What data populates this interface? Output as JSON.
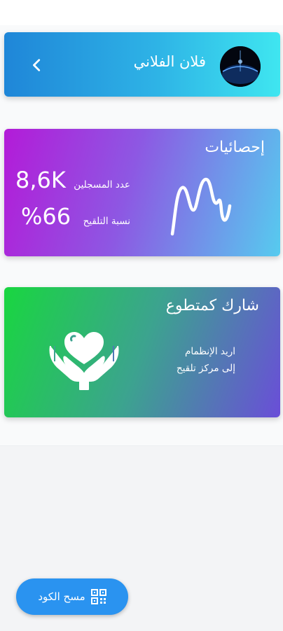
{
  "header": {
    "user_name": "فلان الفلاني",
    "back_icon": "chevron-left-icon",
    "avatar_icon": "planet-avatar"
  },
  "stats": {
    "title": "إحصائيات",
    "registered_label": "عدد المسجلين",
    "registered_value": "8,6K",
    "vaccination_rate_label": "نسبة التلقيح",
    "vaccination_rate_value": "%66",
    "graph_icon": "pulse-graph-icon"
  },
  "volunteer": {
    "title": "شارك كمتطوع",
    "description_line1": "اريد الإنظمام",
    "description_line2": "إلى مركز تلقيح",
    "icon": "hands-heart-icon"
  },
  "scan_button": {
    "label": "مسح الكود",
    "icon": "qr-code-icon"
  },
  "colors": {
    "header_gradient": [
      "#1f86d8",
      "#3fe6f0"
    ],
    "stats_gradient": [
      "#b31bd8",
      "#56cbef"
    ],
    "volunteer_gradient": [
      "#19d640",
      "#6a4ed8"
    ],
    "scan_button": "#2a93f0"
  }
}
